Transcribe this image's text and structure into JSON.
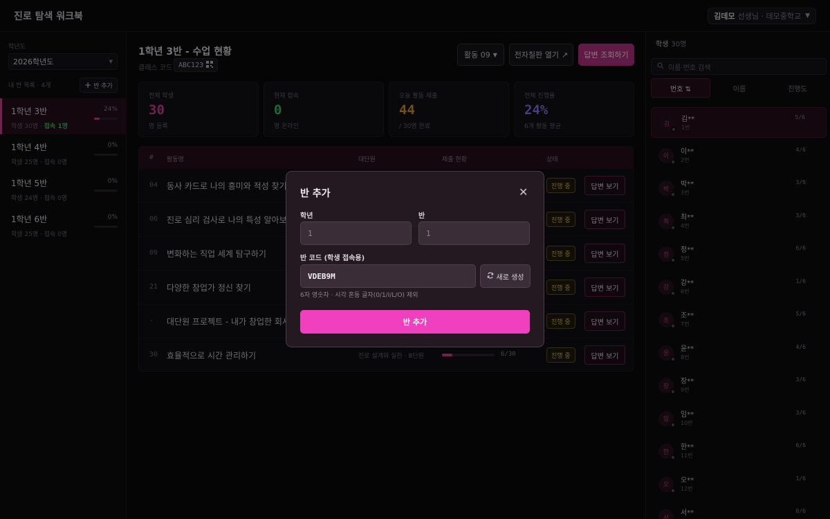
{
  "app": {
    "title": "진로 탐색 워크북"
  },
  "user": {
    "name": "김데모",
    "role": "선생님 · 데모중학교"
  },
  "sidebar": {
    "year_label": "학년도",
    "year_value": "2026학년도",
    "my_classes_label": "내 반 목록 · 4개",
    "add_class_label": "반 추가",
    "classes": [
      {
        "name": "1학년 3반",
        "meta": "학생 30명 · ",
        "conn": "접속 1명",
        "pct": "24%",
        "progress": 24
      },
      {
        "name": "1학년 4반",
        "meta": "학생 25명 · 접속 0명",
        "conn": "",
        "pct": "0%",
        "progress": 0
      },
      {
        "name": "1학년 5반",
        "meta": "학생 24명 · 접속 0명",
        "conn": "",
        "pct": "0%",
        "progress": 0
      },
      {
        "name": "1학년 6반",
        "meta": "학생 25명 · 접속 0명",
        "conn": "",
        "pct": "0%",
        "progress": 0
      }
    ]
  },
  "main": {
    "title": "1학년 3반 - 수업 현황",
    "class_code_label": "클래스 코드",
    "class_code": "ABC123",
    "activity_select": "활동 09",
    "board_button": "전자칠판 열기",
    "answers_button": "답변 조회하기",
    "stats": [
      {
        "label": "전체 학생",
        "value": "30",
        "sub": "명 등록",
        "color": "#e0449b"
      },
      {
        "label": "현재 접속",
        "value": "0",
        "sub": "명 온라인",
        "color": "#3bd36b"
      },
      {
        "label": "오늘 활동 제출",
        "value": "44",
        "sub": "/ 30명 완료",
        "color": "#e6a12a"
      },
      {
        "label": "전체 진행률",
        "value": "24%",
        "sub": "6개 활동 평균",
        "color": "#8a7cf0"
      }
    ],
    "table": {
      "headers": [
        "#",
        "활동명",
        "대단원",
        "제출 현황",
        "상태"
      ],
      "rows": [
        {
          "no": "04",
          "name": "동사 카드로 나의 흥미와 적성 찾기",
          "group": "",
          "progress": 0,
          "count": "",
          "status": "진행 중",
          "view": "답변 보기"
        },
        {
          "no": "06",
          "name": "진로 심리 검사로 나의 특성 알아보기",
          "group": "",
          "progress": 0,
          "count": "",
          "status": "진행 중",
          "view": "답변 보기"
        },
        {
          "no": "09",
          "name": "변화하는 직업 세계 탐구하기",
          "group": "",
          "progress": 0,
          "count": "",
          "status": "진행 중",
          "view": "답변 보기"
        },
        {
          "no": "21",
          "name": "다양한 창업가 정신 찾기",
          "group": "",
          "progress": 0,
          "count": "",
          "status": "진행 중",
          "view": "답변 보기"
        },
        {
          "no": "-",
          "name": "대단원 프로젝트 - 내가 창업한 회사의",
          "group": "",
          "progress": 0,
          "count": "",
          "status": "진행 중",
          "view": "답변 보기"
        },
        {
          "no": "30",
          "name": "효율적으로 시간 관리하기",
          "group": "진로 설계와 실천 · Ⅲ단원",
          "progress": 20,
          "count": "6/30",
          "status": "진행 중",
          "view": "답변 보기"
        }
      ]
    }
  },
  "right": {
    "title": "학생",
    "count": "30명",
    "search_placeholder": "이름·번호 검색",
    "tabs": [
      "번호 ⇅",
      "이름",
      "진행도"
    ],
    "students": [
      {
        "avatar": "김",
        "name": "김**",
        "no": "1번",
        "progress": "5/6"
      },
      {
        "avatar": "이",
        "name": "이**",
        "no": "2번",
        "progress": "4/6"
      },
      {
        "avatar": "박",
        "name": "박**",
        "no": "3번",
        "progress": "3/6"
      },
      {
        "avatar": "최",
        "name": "최**",
        "no": "4번",
        "progress": "3/6"
      },
      {
        "avatar": "정",
        "name": "정**",
        "no": "5번",
        "progress": "6/6"
      },
      {
        "avatar": "강",
        "name": "강**",
        "no": "6번",
        "progress": "1/6"
      },
      {
        "avatar": "조",
        "name": "조**",
        "no": "7번",
        "progress": "5/6"
      },
      {
        "avatar": "윤",
        "name": "윤**",
        "no": "8번",
        "progress": "4/6"
      },
      {
        "avatar": "장",
        "name": "장**",
        "no": "9번",
        "progress": "3/6"
      },
      {
        "avatar": "임",
        "name": "임**",
        "no": "10번",
        "progress": "3/6"
      },
      {
        "avatar": "한",
        "name": "한**",
        "no": "11번",
        "progress": "6/6"
      },
      {
        "avatar": "오",
        "name": "오**",
        "no": "12번",
        "progress": "1/6"
      },
      {
        "avatar": "서",
        "name": "서**",
        "no": "",
        "progress": "0/6"
      }
    ]
  },
  "modal": {
    "title": "반 추가",
    "grade_label": "학년",
    "grade_placeholder": "1",
    "class_label": "반",
    "class_placeholder": "1",
    "code_label": "반 코드 (학생 접속용)",
    "code_value": "VDEB9M",
    "regen_label": "새로 생성",
    "hint": "6자 영숫자 · 시각 혼동 글자(0/1/I/L/O) 제외",
    "submit_label": "반 추가"
  }
}
